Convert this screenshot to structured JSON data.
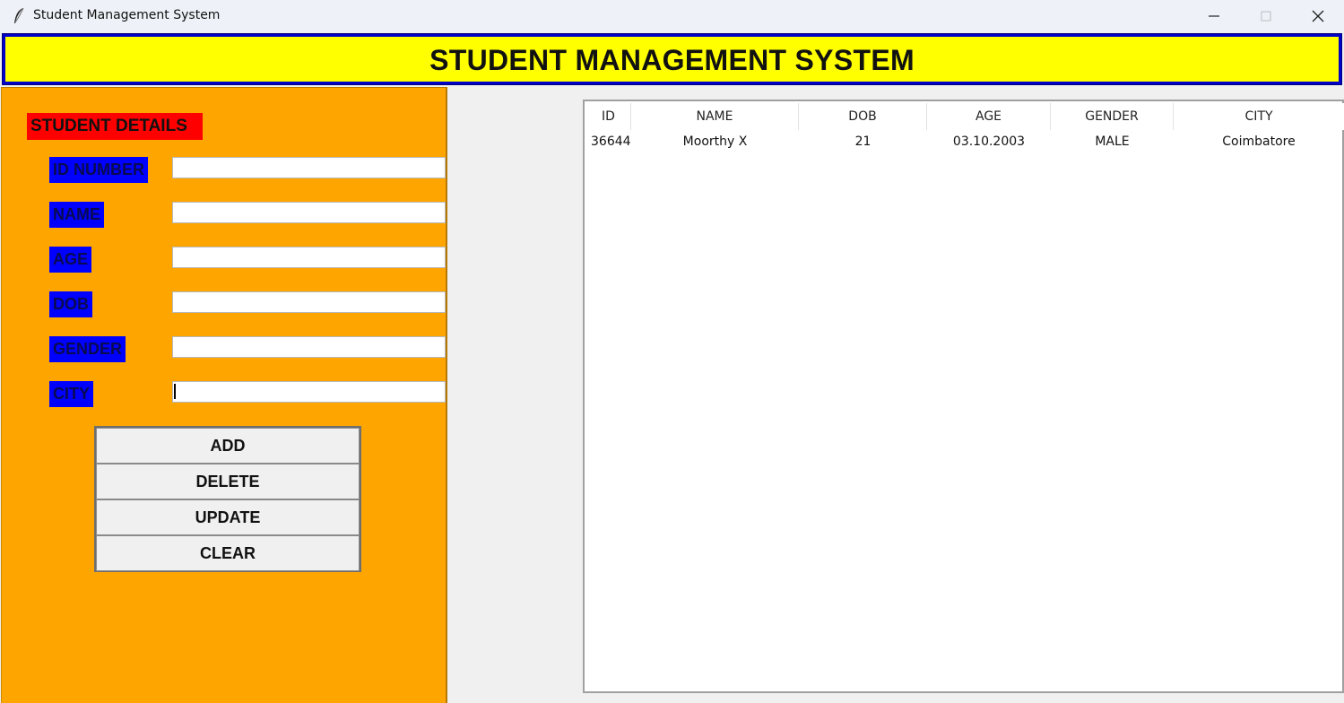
{
  "window": {
    "title": "Student Management System"
  },
  "header": {
    "title": "STUDENT MANAGEMENT SYSTEM",
    "background": "#ffff00",
    "border": "#0000c8"
  },
  "form": {
    "section_title": "STUDENT DETAILS",
    "labels": {
      "id": "ID NUMBER",
      "name": "NAME",
      "age": "AGE",
      "dob": "DOB",
      "gender": "GENDER",
      "city": "CITY"
    },
    "values": {
      "id": "",
      "name": "",
      "age": "",
      "dob": "",
      "gender": "",
      "city": ""
    },
    "colors": {
      "panel": "#ffa500",
      "section_title_bg": "#ff0000",
      "label_bg": "#0000ff"
    }
  },
  "buttons": {
    "add": "ADD",
    "delete": "DELETE",
    "update": "UPDATE",
    "clear": "CLEAR"
  },
  "table": {
    "columns": [
      "ID",
      "NAME",
      "DOB",
      "AGE",
      "GENDER",
      "CITY"
    ],
    "rows": [
      [
        "36644'",
        "Moorthy X",
        "21",
        "03.10.2003",
        "MALE",
        "Coimbatore"
      ]
    ]
  },
  "icons": {
    "app": "feather-icon",
    "minimize": "minimize-icon",
    "maximize": "maximize-icon",
    "close": "close-icon"
  }
}
